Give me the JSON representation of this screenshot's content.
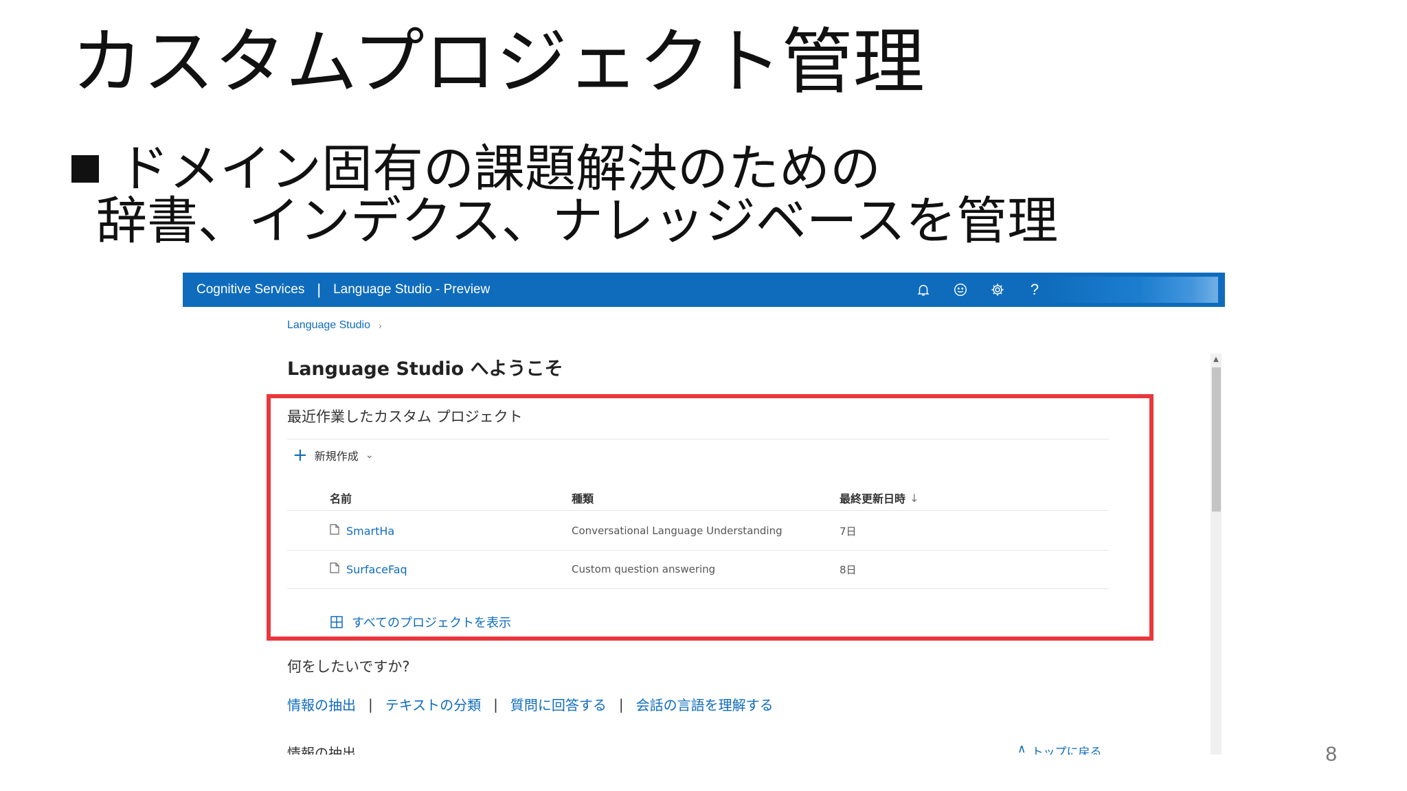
{
  "slide": {
    "title": "カスタムプロジェクト管理",
    "bullet_line1": "ドメイン固有の課題解決のための",
    "bullet_line2": "辞書、インデクス、ナレッジベースを管理",
    "page_number": "8"
  },
  "app": {
    "brand": "Cognitive Services",
    "separator": "|",
    "app_name": "Language Studio - Preview",
    "topbar_color": "#0f6cbd",
    "icons": [
      "bell-icon",
      "smiley-icon",
      "gear-icon",
      "help-icon"
    ],
    "help_glyph": "?"
  },
  "breadcrumb": {
    "item": "Language Studio",
    "chevron": "›"
  },
  "welcome": "Language Studio へようこそ",
  "recent": {
    "heading": "最近作業したカスタム プロジェクト",
    "new_button": "新規作成",
    "caret": "⌄",
    "columns": {
      "name": "名前",
      "type": "種類",
      "updated": "最終更新日時",
      "sort_arrow": "↓"
    },
    "rows": [
      {
        "name": "SmartHa",
        "type": "Conversational Language Understanding",
        "updated": "7日"
      },
      {
        "name": "SurfaceFaq",
        "type": "Custom question answering",
        "updated": "8日"
      }
    ],
    "view_all": "すべてのプロジェクトを表示",
    "highlight_color": "#e8383d"
  },
  "question": "何をしたいですか?",
  "quick_links": [
    "情報の抽出",
    "テキストの分類",
    "質問に回答する",
    "会話の言語を理解する"
  ],
  "quick_link_separator": "|",
  "section_heading": "情報の抽出",
  "back_to_top": "トップに戻る",
  "back_to_top_arrow": "∧"
}
